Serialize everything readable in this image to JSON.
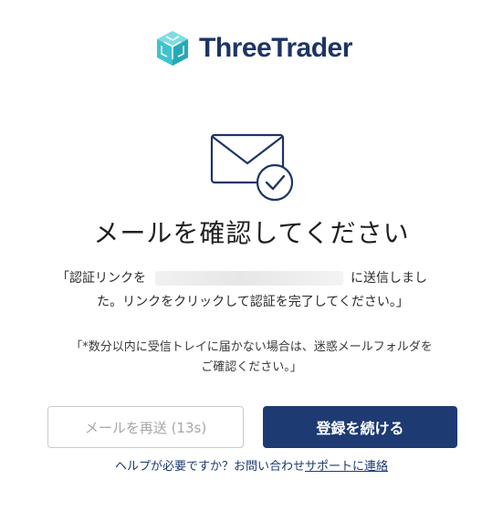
{
  "brand": {
    "name": "ThreeTrader"
  },
  "page": {
    "title": "メールを確認してください"
  },
  "message": {
    "prefix": "「認証リンクを",
    "suffix": "に送信しまし",
    "line2": "た。リンクをクリックして認証を完了してください。」"
  },
  "note": {
    "line1": "「*数分以内に受信トレイに届かない場合は、迷惑メールフォルダを",
    "line2": "ご確認ください。」"
  },
  "buttons": {
    "resend": "メールを再送 (13s)",
    "continue": "登録を続ける"
  },
  "help": {
    "text": "ヘルプが必要ですか？お問い合わせ",
    "link": "サポートに連絡"
  },
  "colors": {
    "brand_navy": "#1d3a72",
    "brand_teal": "#3cc3cf"
  }
}
